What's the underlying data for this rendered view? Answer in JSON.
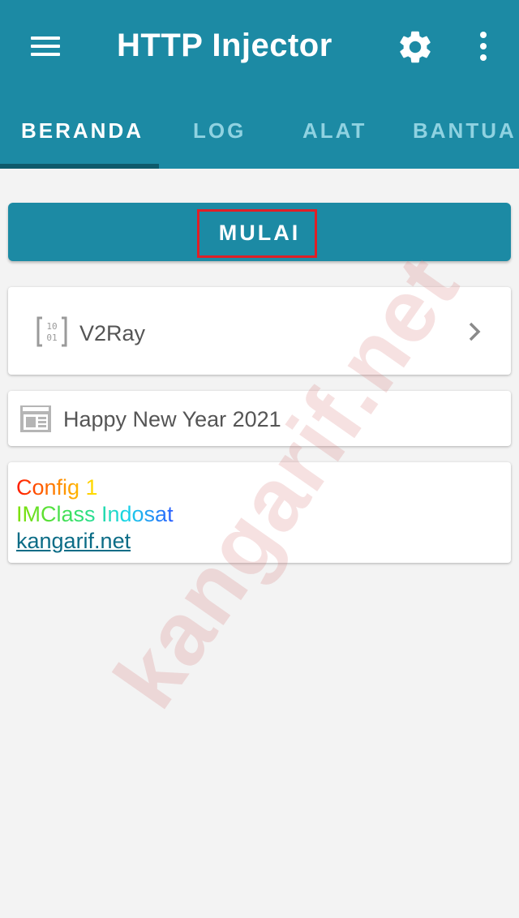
{
  "appbar": {
    "title": "HTTP Injector",
    "color": "#1c8aa4",
    "icons": [
      "menu-icon",
      "settings-gear-icon",
      "more-vertical-icon"
    ]
  },
  "tabs": [
    {
      "label": "BERANDA",
      "active": true
    },
    {
      "label": "LOG",
      "active": false
    },
    {
      "label": "ALAT",
      "active": false
    },
    {
      "label": "BANTUA",
      "active": false
    }
  ],
  "start_button": {
    "label": "MULAI"
  },
  "v2ray_card": {
    "label": "V2Ray",
    "icon": "binary-icon"
  },
  "note_card": {
    "text": "Happy New Year 2021",
    "icon": "calendar-icon"
  },
  "config_card": {
    "line1": "Config 1",
    "line2": "IMClass Indosat",
    "link": "kangarif.net"
  },
  "watermark": "kangarif.net"
}
